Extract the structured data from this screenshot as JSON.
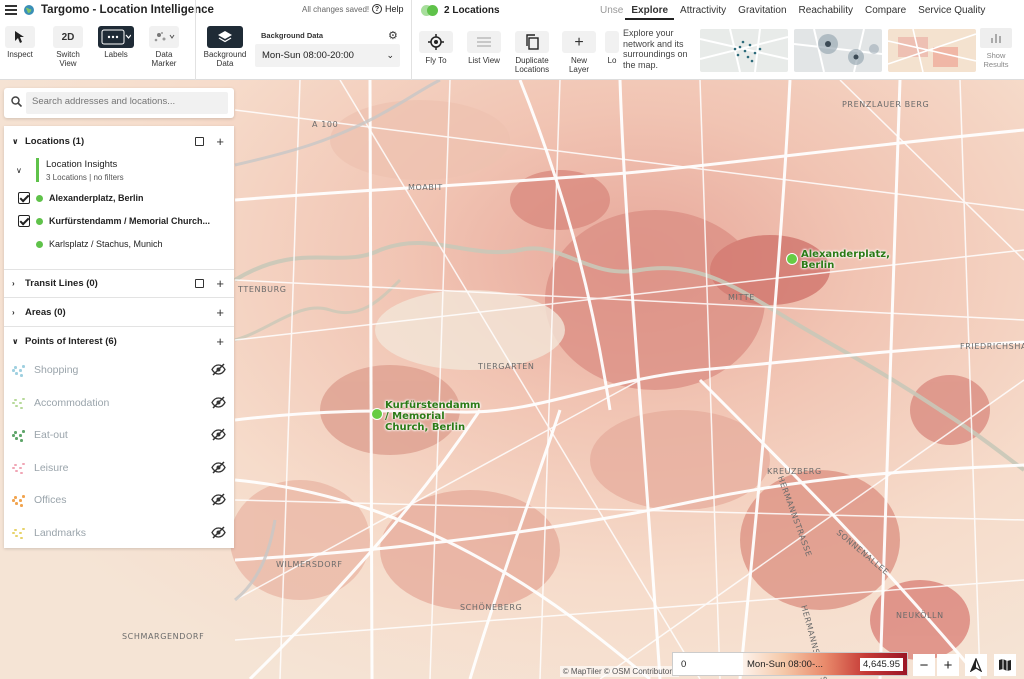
{
  "app": {
    "title": "Targomo - Location Intelligence",
    "saved_status": "All changes saved!",
    "help_label": "Help"
  },
  "toolbar": {
    "inspect": "Inspect",
    "switch_view_badge": "2D",
    "switch_view": "Switch View",
    "labels": "Labels",
    "data_marker": "Data Marker",
    "background_data": "Background Data"
  },
  "background_data": {
    "label": "Background Data",
    "selected": "Mon-Sun 08:00-20:00"
  },
  "locations_bar": {
    "count_label": "2 Locations",
    "tabs": [
      {
        "label": "Unse",
        "state": "faded"
      },
      {
        "label": "Explore",
        "state": "active"
      },
      {
        "label": "Attractivity",
        "state": "normal"
      },
      {
        "label": "Gravitation",
        "state": "normal"
      },
      {
        "label": "Reachability",
        "state": "normal"
      },
      {
        "label": "Compare",
        "state": "normal"
      },
      {
        "label": "Service Quality",
        "state": "normal"
      }
    ],
    "tools": {
      "fly_to": "Fly To",
      "list_view": "List View",
      "duplicate": "Duplicate Locations",
      "new_layer": "New Layer",
      "cut": "Lo"
    },
    "explore_text": "Explore your network and its surroundings on the map.",
    "show_results": "Show Results"
  },
  "search": {
    "placeholder": "Search addresses and locations..."
  },
  "panel": {
    "locations_header": "Locations (1)",
    "insights_title": "Location Insights",
    "insights_sub": "3 Locations | no filters",
    "locations": [
      {
        "name": "Alexanderplatz, Berlin",
        "checked": true
      },
      {
        "name": "Kurfürstendamm / Memorial Church...",
        "checked": true
      },
      {
        "name": "Karlsplatz / Stachus, Munich",
        "checked": false
      }
    ],
    "transit_header": "Transit Lines (0)",
    "areas_header": "Areas (0)",
    "poi_header": "Points of Interest (6)",
    "poi": [
      {
        "label": "Shopping",
        "color": "#9fd0e0"
      },
      {
        "label": "Accommodation",
        "color": "#b7d99a"
      },
      {
        "label": "Eat-out",
        "color": "#5fa56a"
      },
      {
        "label": "Leisure",
        "color": "#f0a6b5"
      },
      {
        "label": "Offices",
        "color": "#f1a44f"
      },
      {
        "label": "Landmarks",
        "color": "#e7d36a"
      }
    ]
  },
  "map": {
    "markers": [
      {
        "label": "Alexanderplatz, Berlin"
      },
      {
        "label": "Kurfürstendamm / Memorial Church, Berlin"
      }
    ],
    "district_labels": [
      "PRENZLAUER BERG",
      "MOABIT",
      "MITTE",
      "TIERGARTEN",
      "FRIEDRICHSHAIN",
      "KREUZBERG",
      "SCHÖNEBERG",
      "WILMERSDORF",
      "SCHMARGENDORF",
      "NEUKÖLLN",
      "A 100",
      "TTENBURG",
      "SONNENALLEE",
      "HERMANNSTRASSE",
      "HERMANNSTRASSE"
    ],
    "attribution": "© MapTiler  © OSM Contributors"
  },
  "legend": {
    "min": "0",
    "time": "Mon-Sun 08:00-...",
    "max": "4,645.95"
  },
  "colors": {
    "accent_green": "#5fc24a",
    "location_label": "#2b7a16",
    "heat_high": "#9b1625"
  }
}
